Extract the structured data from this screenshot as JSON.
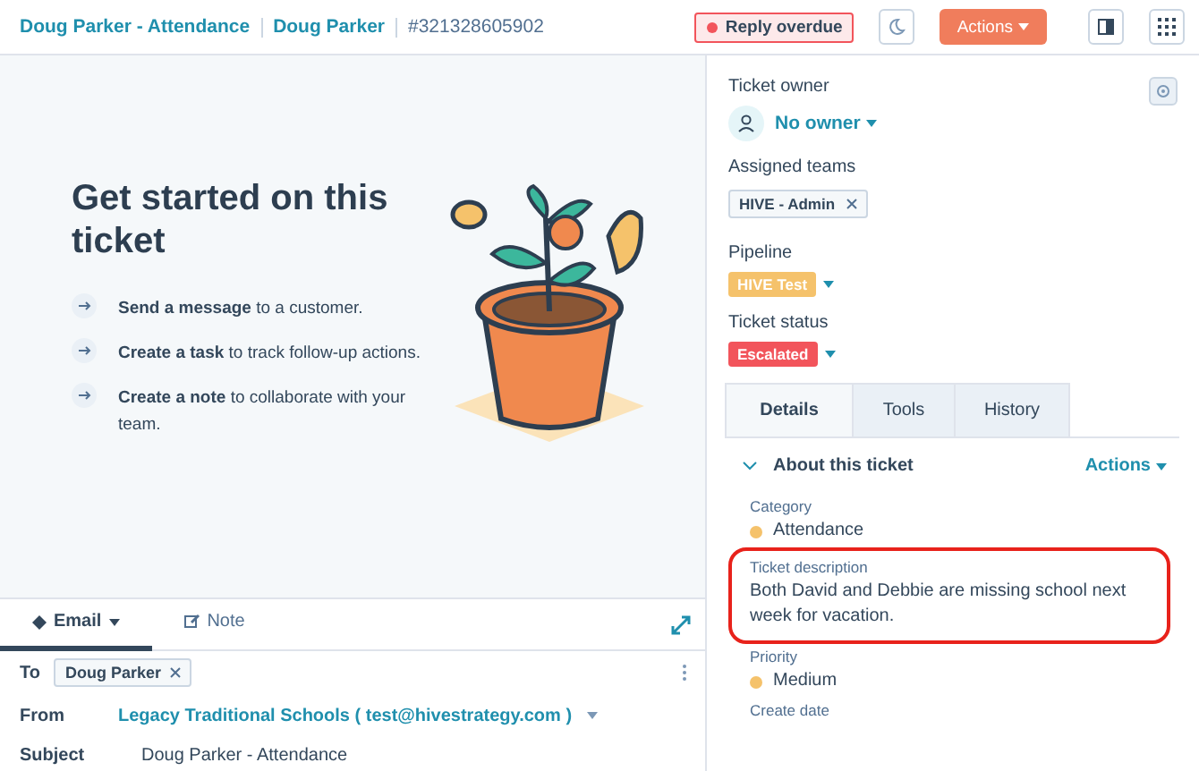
{
  "header": {
    "title": "Doug Parker - Attendance",
    "contact": "Doug Parker",
    "ticket_id": "#321328605902",
    "badge": "Reply overdue",
    "actions": "Actions"
  },
  "getting_started": {
    "title": "Get started on this ticket",
    "steps": [
      {
        "text": "**Send a message** to a customer."
      },
      {
        "text": "**Create a task** to track follow-up actions."
      },
      {
        "text": "**Create a note** to collaborate with your team."
      }
    ]
  },
  "composer": {
    "tabs": [
      {
        "label": "Email",
        "selected": true
      },
      {
        "label": "Note",
        "selected": false
      }
    ],
    "to": {
      "label": "To",
      "recipient": "Doug Parker"
    },
    "from": {
      "label": "From",
      "value": "Legacy Traditional Schools ( test@hivestrategy.com )"
    },
    "subject": {
      "label": "Subject",
      "value": "Doug Parker - Attendance"
    }
  },
  "sidebar": {
    "owner": {
      "label": "Ticket owner",
      "value": "No owner"
    },
    "teams": {
      "label": "Assigned teams",
      "tags": [
        "HIVE - Admin"
      ]
    },
    "pipeline": {
      "label": "Pipeline",
      "value": "HIVE Test",
      "color": "#f5c26b"
    },
    "status": {
      "label": "Ticket status",
      "value": "Escalated",
      "color": "#f2545b"
    },
    "tabs": [
      {
        "label": "Details",
        "selected": true
      },
      {
        "label": "Tools",
        "selected": false
      },
      {
        "label": "History",
        "selected": false
      }
    ],
    "section": {
      "title": "About this ticket",
      "expanded": true,
      "actions": "Actions"
    },
    "fields": [
      {
        "label": "Category",
        "value": "Attendance",
        "color": "#f5c26b",
        "highlighted": false
      },
      {
        "label": "Ticket description",
        "value": "Both David and Debbie are missing school next week for vacation.",
        "highlighted": true
      },
      {
        "label": "Priority",
        "value": "Medium",
        "color": "#f5c26b",
        "highlighted": false
      },
      {
        "label": "Create date",
        "highlighted": false
      }
    ]
  }
}
